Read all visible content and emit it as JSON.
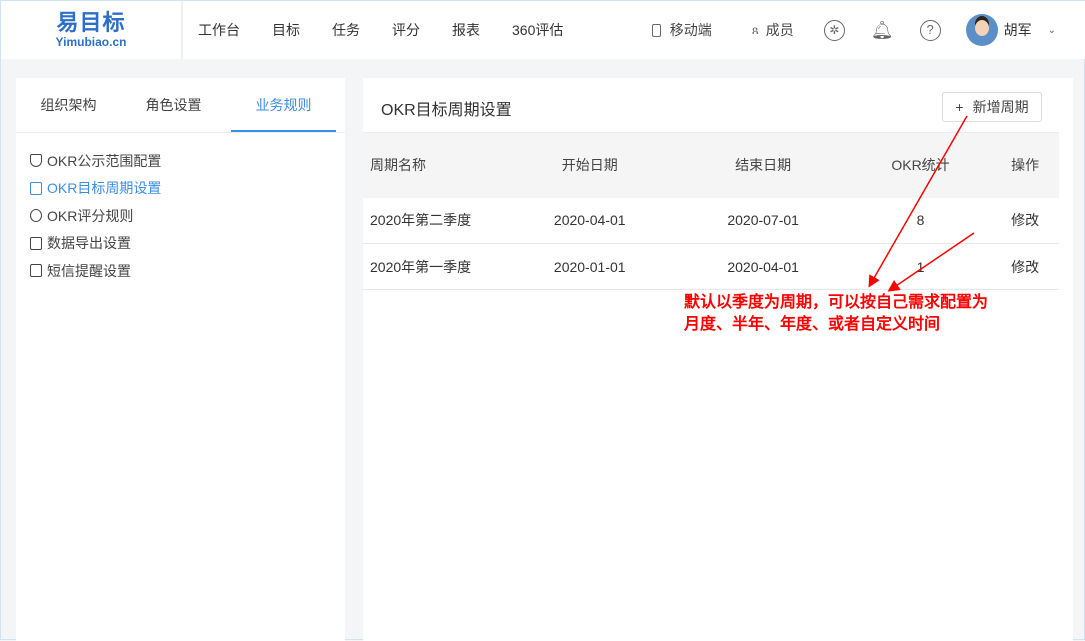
{
  "logo": {
    "cn": "易目标",
    "en": "Yimubiao.cn"
  },
  "nav": [
    "工作台",
    "目标",
    "任务",
    "评分",
    "报表",
    "360评估"
  ],
  "header": {
    "mobile": "移动端",
    "members": "成员",
    "user": "胡军"
  },
  "left": {
    "tabs": [
      "组织架构",
      "角色设置",
      "业务规则"
    ],
    "menu": [
      "OKR公示范围配置",
      "OKR目标周期设置",
      "OKR评分规则",
      "数据导出设置",
      "短信提醒设置"
    ]
  },
  "main": {
    "title": "OKR目标周期设置",
    "add": "新增周期",
    "columns": [
      "周期名称",
      "开始日期",
      "结束日期",
      "OKR统计",
      "操作"
    ],
    "rows": [
      [
        "2020年第二季度",
        "2020-04-01",
        "2020-07-01",
        "8",
        "修改"
      ],
      [
        "2020年第一季度",
        "2020-01-01",
        "2020-04-01",
        "1",
        "修改"
      ]
    ]
  },
  "annotation": [
    "默认以季度为周期，可以按自己需求配置为",
    "月度、半年、年度、或者自定义时间"
  ]
}
